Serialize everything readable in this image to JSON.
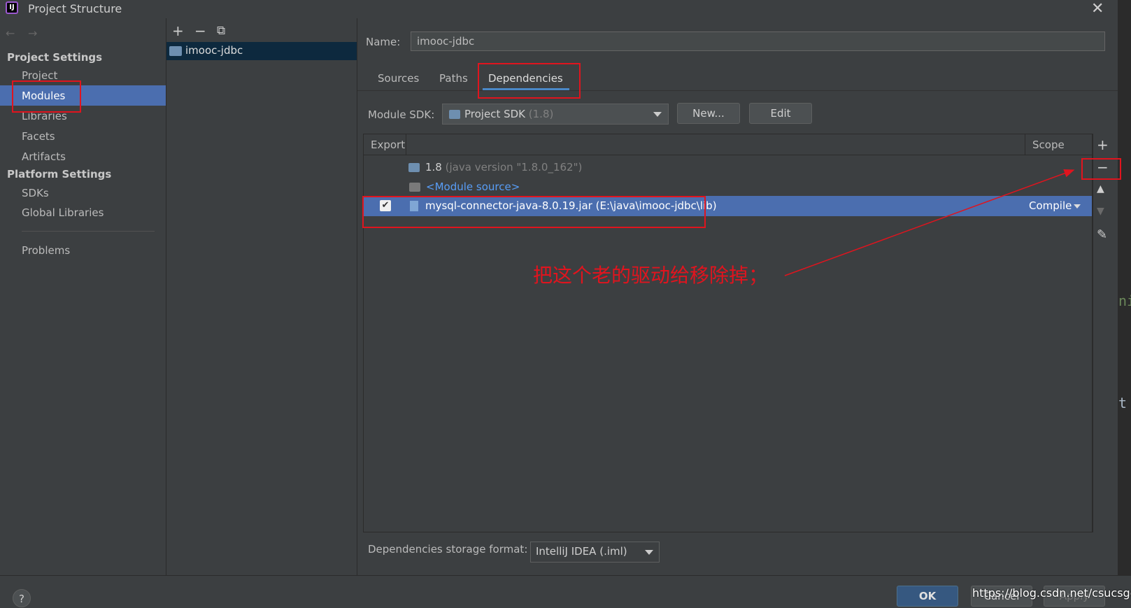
{
  "window": {
    "title": "Project Structure",
    "app_icon": "intellij-idea-icon"
  },
  "sidebar": {
    "project_settings_header": "Project Settings",
    "project_items": [
      "Project",
      "Modules",
      "Libraries",
      "Facets",
      "Artifacts"
    ],
    "selected": "Modules",
    "platform_settings_header": "Platform Settings",
    "platform_items": [
      "SDKs",
      "Global Libraries"
    ],
    "problems": "Problems"
  },
  "modules": {
    "items": [
      "imooc-jdbc"
    ],
    "selected": "imooc-jdbc"
  },
  "name": {
    "label": "Name:",
    "value": "imooc-jdbc"
  },
  "tabs": {
    "items": [
      "Sources",
      "Paths",
      "Dependencies"
    ],
    "active": "Dependencies"
  },
  "sdk": {
    "label": "Module SDK:",
    "value": "Project SDK",
    "version": "(1.8)",
    "new_button": "New...",
    "edit_button": "Edit"
  },
  "dependencies_table": {
    "columns": [
      "Export",
      "Scope"
    ],
    "rows": [
      {
        "name": "1.8",
        "detail": "(java version \"1.8.0_162\")",
        "scope": ""
      },
      {
        "name": "<Module source>",
        "detail": "",
        "scope": ""
      },
      {
        "name": "mysql-connector-java-8.0.19.jar (E:\\java\\imooc-jdbc\\lib)",
        "detail": "",
        "scope": "Compile",
        "exported": true
      }
    ]
  },
  "storage_format": {
    "label": "Dependencies storage format:",
    "value": "IntelliJ IDEA (.iml)"
  },
  "footer": {
    "ok": "OK",
    "cancel": "Cancel",
    "apply": "Apply",
    "help": "?"
  },
  "annotation": {
    "text": "把这个老的驱动给移除掉；",
    "color": "#e0141e"
  },
  "watermark": "https://blog.csdn.net/csucsgoat",
  "editor_glyphs": [
    "ni",
    "t"
  ],
  "colors": {
    "selection": "#4b6eaf",
    "background": "#3c3f41",
    "link": "#589df6",
    "annotation": "#e0141e"
  }
}
